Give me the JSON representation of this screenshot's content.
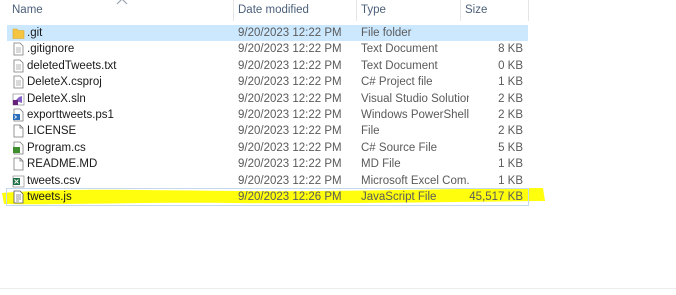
{
  "columns": {
    "name": "Name",
    "date": "Date modified",
    "type": "Type",
    "size": "Size"
  },
  "files": [
    {
      "name": ".git",
      "date": "9/20/2023 12:22 PM",
      "type": "File folder",
      "size": "",
      "icon": "folder-icon"
    },
    {
      "name": ".gitignore",
      "date": "9/20/2023 12:22 PM",
      "type": "Text Document",
      "size": "8 KB",
      "icon": "text-file-icon"
    },
    {
      "name": "deletedTweets.txt",
      "date": "9/20/2023 12:22 PM",
      "type": "Text Document",
      "size": "0 KB",
      "icon": "text-file-icon"
    },
    {
      "name": "DeleteX.csproj",
      "date": "9/20/2023 12:22 PM",
      "type": "C# Project file",
      "size": "1 KB",
      "icon": "project-file-icon"
    },
    {
      "name": "DeleteX.sln",
      "date": "9/20/2023 12:22 PM",
      "type": "Visual Studio Solution",
      "size": "2 KB",
      "icon": "visual-studio-icon"
    },
    {
      "name": "exporttweets.ps1",
      "date": "9/20/2023 12:22 PM",
      "type": "Windows PowerShell ...",
      "size": "2 KB",
      "icon": "powershell-icon"
    },
    {
      "name": "LICENSE",
      "date": "9/20/2023 12:22 PM",
      "type": "File",
      "size": "2 KB",
      "icon": "generic-file-icon"
    },
    {
      "name": "Program.cs",
      "date": "9/20/2023 12:22 PM",
      "type": "C# Source File",
      "size": "5 KB",
      "icon": "csharp-file-icon"
    },
    {
      "name": "README.MD",
      "date": "9/20/2023 12:22 PM",
      "type": "MD File",
      "size": "1 KB",
      "icon": "generic-file-icon"
    },
    {
      "name": "tweets.csv",
      "date": "9/20/2023 12:22 PM",
      "type": "Microsoft Excel Com...",
      "size": "1 KB",
      "icon": "excel-file-icon"
    },
    {
      "name": "tweets.js",
      "date": "9/20/2023 12:26 PM",
      "type": "JavaScript File",
      "size": "45,517 KB",
      "icon": "javascript-file-icon"
    }
  ],
  "colors": {
    "selection": "#cce8ff",
    "highlighter": "#ffff00",
    "header_text": "#4c607a"
  }
}
